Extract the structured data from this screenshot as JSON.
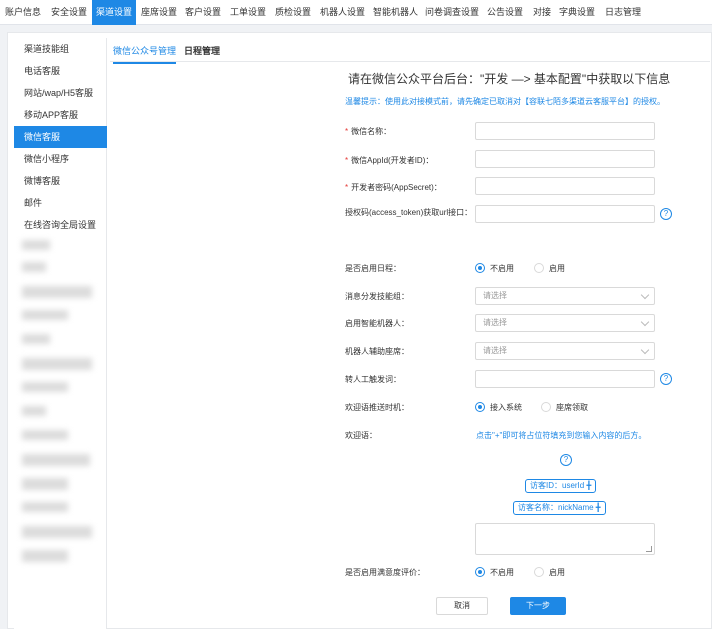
{
  "topnav": {
    "items": [
      "账户信息",
      "安全设置",
      "渠道设置",
      "座席设置",
      "客户设置",
      "工单设置",
      "质检设置",
      "机器人设置",
      "智能机器人",
      "问卷调查设置",
      "公告设置",
      "对接",
      "字典设置",
      "日志管理"
    ],
    "active_index": 2
  },
  "sidebar": {
    "items": [
      "渠道技能组",
      "电话客服",
      "网站/wap/H5客服",
      "移动APP客服",
      "微信客服",
      "微信小程序",
      "微博客服",
      "邮件",
      "在线咨询全局设置"
    ],
    "active_index": 4
  },
  "tabs": [
    "微信公众号管理",
    "日程管理"
  ],
  "form": {
    "heading": "请在微信公众平台后台：\"开发 —> 基本配置\"中获取以下信息",
    "hint": "温馨提示：使用此对接模式前，请先确定已取消对【容联七陌多渠道云客服平台】的授权。",
    "required_mark": "*",
    "labels": {
      "wechat_name": "微信名称：",
      "appid": "微信AppId(开发者ID)：",
      "appsecret": "开发者密码(AppSecret)：",
      "auth_url": "授权码(access_token)获取url接口：",
      "enable_schedule": "是否启用日程：",
      "skill_group": "消息分发技能组：",
      "robot": "启用智能机器人：",
      "assist_seat": "机器人辅助座席：",
      "transfer_word": "转人工触发词：",
      "welcome_timing": "欢迎语推送时机：",
      "welcome": "欢迎语：",
      "enable_satisfaction": "是否启用满意度评价："
    },
    "radio": {
      "off": "不启用",
      "on": "启用",
      "on_access": "接入系统",
      "seat_claim": "座席领取"
    },
    "select_placeholder": "请选择",
    "help_icon": "?",
    "welcome_note": "点击\"+\"即可将占位符填充到您输入内容的后方。",
    "tag_userid": "访客ID：userId ╋",
    "tag_nickname": "访客名称：nickName ╋",
    "cancel": "取消",
    "next": "下一步"
  },
  "colors": {
    "accent": "#1e88e5",
    "required": "#e53935"
  }
}
